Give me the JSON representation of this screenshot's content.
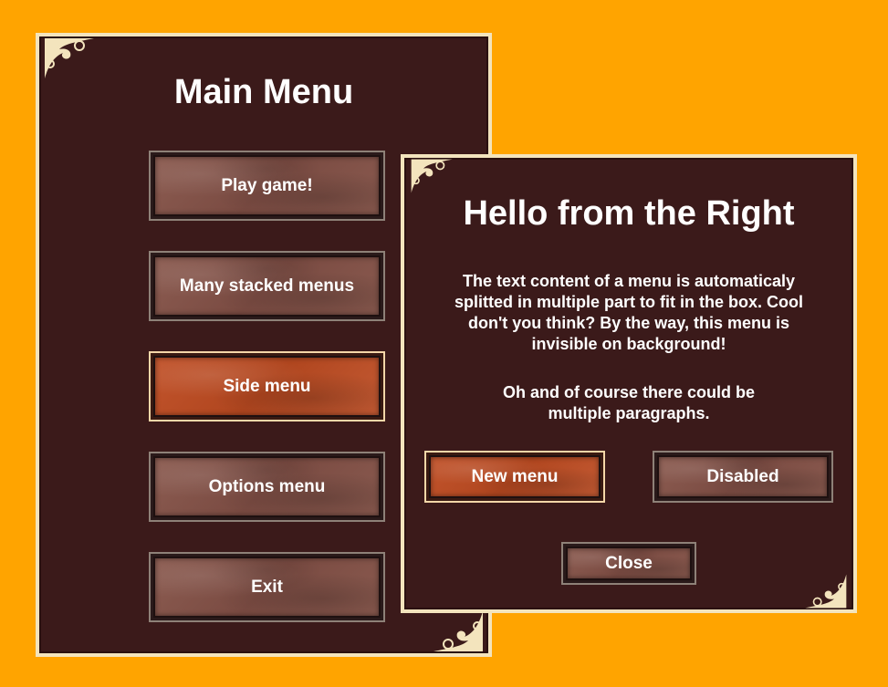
{
  "main_menu": {
    "title": "Main Menu",
    "buttons": [
      {
        "label": "Play game!",
        "state": "normal"
      },
      {
        "label": "Many stacked menus",
        "state": "normal"
      },
      {
        "label": "Side menu",
        "state": "active"
      },
      {
        "label": "Options menu",
        "state": "normal"
      },
      {
        "label": "Exit",
        "state": "normal"
      }
    ]
  },
  "side_menu": {
    "title": "Hello from the Right",
    "paragraphs": [
      "The text content of a menu is automaticaly splitted in multiple part to fit in the box. Cool don't you think? By the way, this menu is invisible on background!",
      "Oh and of course there could be multiple paragraphs."
    ],
    "buttons": {
      "new_menu": {
        "label": "New menu",
        "state": "active"
      },
      "disabled": {
        "label": "Disabled",
        "state": "disabled"
      },
      "close": {
        "label": "Close",
        "state": "normal"
      }
    }
  },
  "colors": {
    "background": "#ffa400",
    "panel": "#3b1a1a",
    "panel_border": "#f3e4bd",
    "button_face": "#7a4b42",
    "button_active": "#b0461f"
  },
  "icons": [
    "ornament-corner-icon"
  ]
}
